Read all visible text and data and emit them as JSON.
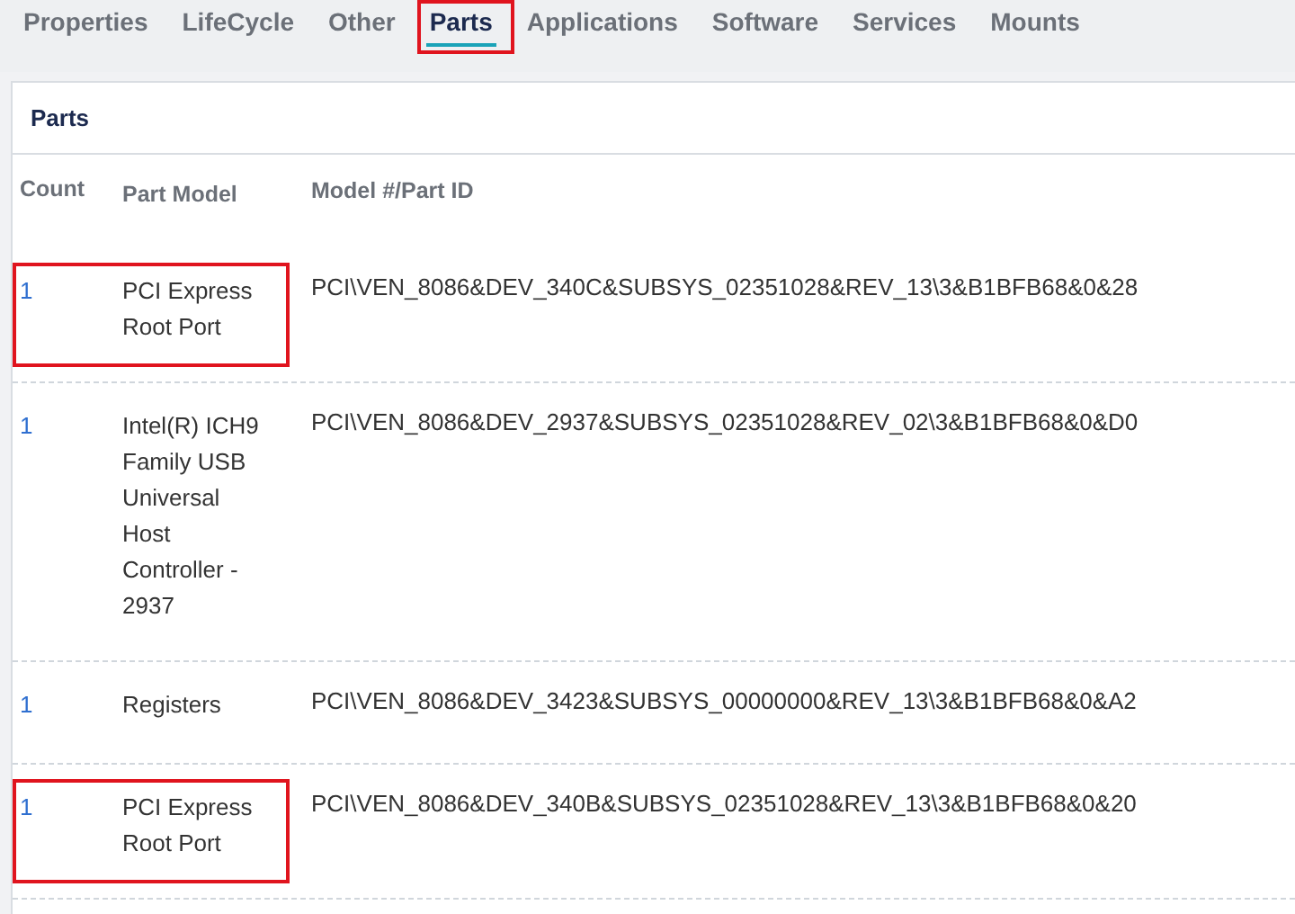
{
  "tabs": [
    {
      "label": "Properties",
      "selected": false,
      "highlighted": false
    },
    {
      "label": "LifeCycle",
      "selected": false,
      "highlighted": false
    },
    {
      "label": "Other",
      "selected": false,
      "highlighted": false
    },
    {
      "label": "Parts",
      "selected": true,
      "highlighted": true
    },
    {
      "label": "Applications",
      "selected": false,
      "highlighted": false
    },
    {
      "label": "Software",
      "selected": false,
      "highlighted": false
    },
    {
      "label": "Services",
      "selected": false,
      "highlighted": false
    },
    {
      "label": "Mounts",
      "selected": false,
      "highlighted": false
    }
  ],
  "panel": {
    "title": "Parts",
    "table": {
      "columns": [
        "Count",
        "Part Model",
        "Model #/Part ID"
      ],
      "rows": [
        {
          "count": "1",
          "part_model": "PCI Express Root Port",
          "part_id": "PCI\\VEN_8086&DEV_340C&SUBSYS_02351028&REV_13\\3&B1BFB68&0&28",
          "highlighted": true
        },
        {
          "count": "1",
          "part_model": "Intel(R) ICH9 Family USB Universal Host Controller - 2937",
          "part_id": "PCI\\VEN_8086&DEV_2937&SUBSYS_02351028&REV_02\\3&B1BFB68&0&D0",
          "highlighted": false
        },
        {
          "count": "1",
          "part_model": "Registers",
          "part_id": "PCI\\VEN_8086&DEV_3423&SUBSYS_00000000&REV_13\\3&B1BFB68&0&A2",
          "highlighted": false
        },
        {
          "count": "1",
          "part_model": "PCI Express Root Port",
          "part_id": "PCI\\VEN_8086&DEV_340B&SUBSYS_02351028&REV_13\\3&B1BFB68&0&20",
          "highlighted": true
        }
      ]
    }
  }
}
